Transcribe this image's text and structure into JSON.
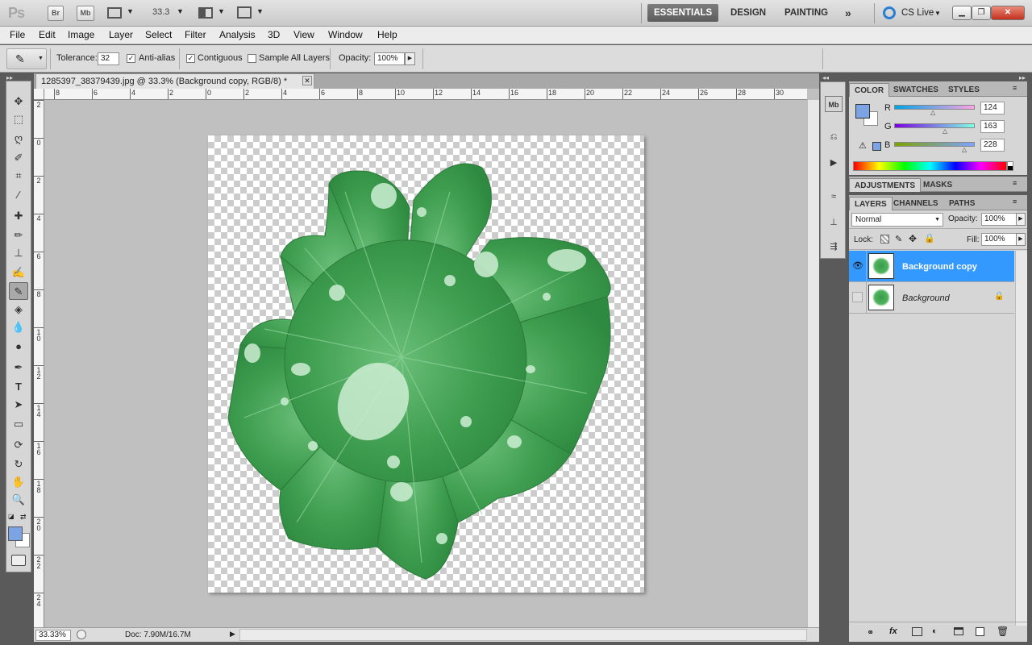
{
  "appbar": {
    "logo": "Ps",
    "bridge": "Br",
    "minibridge": "Mb",
    "zoom": "33.3",
    "workspaces": [
      "ESSENTIALS",
      "DESIGN",
      "PAINTING"
    ],
    "more": "»",
    "cslive": "CS Live"
  },
  "menu": [
    "File",
    "Edit",
    "Image",
    "Layer",
    "Select",
    "Filter",
    "Analysis",
    "3D",
    "View",
    "Window",
    "Help"
  ],
  "options": {
    "tolerance_label": "Tolerance:",
    "tolerance_value": "32",
    "antialias_label": "Anti-alias",
    "antialias_checked": true,
    "contiguous_label": "Contiguous",
    "contiguous_checked": true,
    "sample_all_label": "Sample All Layers",
    "sample_all_checked": false,
    "opacity_label": "Opacity:",
    "opacity_value": "100%"
  },
  "document": {
    "tab_title": "1285397_38379439.jpg @ 33.3% (Background copy, RGB/8) *",
    "ruler_top": [
      "8",
      "6",
      "4",
      "2",
      "0",
      "2",
      "4",
      "6",
      "8",
      "10",
      "12",
      "14",
      "16",
      "18",
      "20",
      "22",
      "24",
      "26",
      "28",
      "30"
    ],
    "ruler_left": [
      "2",
      "0",
      "2",
      "4",
      "6",
      "8",
      "10",
      "12",
      "14",
      "16",
      "18",
      "20",
      "22",
      "24"
    ]
  },
  "status": {
    "zoom": "33.33%",
    "doc_info": "Doc: 7.90M/16.7M"
  },
  "color_panel": {
    "tabs": [
      "COLOR",
      "SWATCHES",
      "STYLES"
    ],
    "r_label": "R",
    "r": "124",
    "g_label": "G",
    "g": "163",
    "b_label": "B",
    "b": "228",
    "foreground": "#7ca3e4",
    "background": "#ffffff"
  },
  "adjustments_panel": {
    "tabs": [
      "ADJUSTMENTS",
      "MASKS"
    ]
  },
  "layers_panel": {
    "tabs": [
      "LAYERS",
      "CHANNELS",
      "PATHS"
    ],
    "blend_mode": "Normal",
    "opacity_label": "Opacity:",
    "opacity": "100%",
    "lock_label": "Lock:",
    "fill_label": "Fill:",
    "fill": "100%",
    "layers": [
      {
        "name": "Background copy",
        "selected": true,
        "visible": true,
        "locked": false
      },
      {
        "name": "Background",
        "selected": false,
        "visible": false,
        "locked": true
      }
    ]
  },
  "colors": {
    "accent": "#3399ff",
    "leaf": "#4caf50"
  }
}
